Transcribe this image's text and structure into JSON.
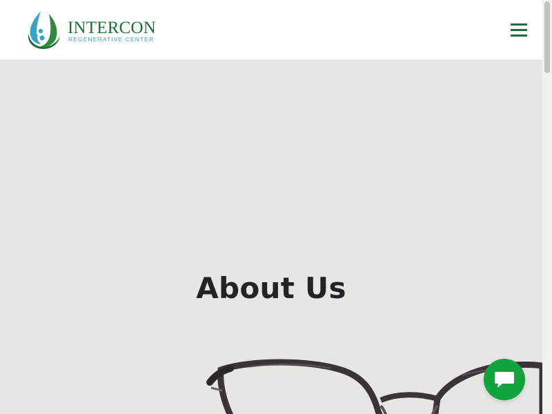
{
  "header": {
    "logo": {
      "name": "INTERCON",
      "subtitle": "REGENERATIVE CENTER",
      "icon": "leaf-drop-logo-icon"
    },
    "menu_icon": "hamburger-menu-icon"
  },
  "hero": {
    "title": "About Us",
    "image": "eyeglasses-image"
  },
  "chat": {
    "icon": "chat-bubble-icon"
  },
  "colors": {
    "brand_green": "#1f6e3a",
    "accent_blue": "#3aa3c7",
    "hero_background": "#e7e6e3",
    "chat_green": "#12a33e",
    "title_text": "#222326"
  }
}
